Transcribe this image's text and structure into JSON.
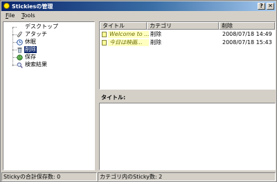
{
  "window": {
    "title": "Stickiesの管理",
    "help_button": "?",
    "close_button": "✕"
  },
  "menu": [
    {
      "underline": "F",
      "rest": "ile"
    },
    {
      "underline": "T",
      "rest": "ools"
    }
  ],
  "tree": {
    "items": [
      {
        "label": "デスクトップ",
        "icon": "none"
      },
      {
        "label": "アタッチ",
        "icon": "paperclip-icon"
      },
      {
        "label": "休眠",
        "icon": "clock-icon"
      },
      {
        "label": "削除",
        "icon": "trash-icon",
        "selected": true
      },
      {
        "label": "保存",
        "icon": "globe-icon"
      },
      {
        "label": "検索結果",
        "icon": "magnifier-icon"
      }
    ]
  },
  "list": {
    "columns": [
      "タイトル",
      "カテゴリ",
      "削除"
    ],
    "rows": [
      {
        "title": "Welcome to ...",
        "category": "削除",
        "date": "2008/07/18 14:49"
      },
      {
        "title": "今日は映画...",
        "category": "削除",
        "date": "2008/07/18 15:43"
      }
    ]
  },
  "detail": {
    "title_label": "タイトル:"
  },
  "status": {
    "left": "Stickyの合計保存数: 0",
    "right": "カテゴリ内のSticky数: 2"
  }
}
